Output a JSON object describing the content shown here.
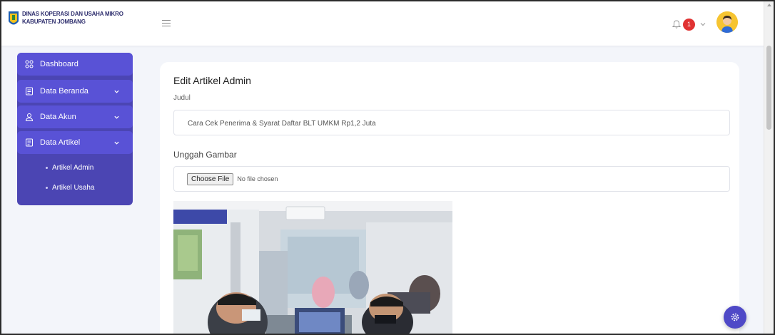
{
  "brand": {
    "line1": "DINAS KOPERASI DAN USAHA MIKRO",
    "line2": "KABUPATEN JOMBANG"
  },
  "header": {
    "notification_count": "1",
    "icons": [
      "hamburger-icon",
      "bell-icon",
      "chevron-down-icon",
      "user-avatar"
    ]
  },
  "sidebar": {
    "items": [
      {
        "label": "Dashboard",
        "icon": "grid-icon",
        "has_chevron": false
      },
      {
        "label": "Data Beranda",
        "icon": "document-icon",
        "has_chevron": true
      },
      {
        "label": "Data Akun",
        "icon": "user-icon",
        "has_chevron": true
      },
      {
        "label": "Data Artikel",
        "icon": "document-icon",
        "has_chevron": true
      }
    ],
    "subitems": [
      {
        "label": "Artikel Admin"
      },
      {
        "label": "Artikel Usaha"
      }
    ]
  },
  "form": {
    "title": "Edit Artikel Admin",
    "judul_label": "Judul",
    "judul_value": "Cara Cek Penerima & Syarat Daftar BLT UMKM Rp1,2 Juta",
    "upload_label": "Unggah Gambar",
    "file_button": "Choose File",
    "file_status": "No file chosen"
  },
  "colors": {
    "sidebar_bg": "#4b45b3",
    "nav_item_bg": "#5952d6",
    "page_bg": "#f3f5fa",
    "badge": "#e03232",
    "fab": "#4f49c7"
  },
  "fab_icon": "gear-icon"
}
